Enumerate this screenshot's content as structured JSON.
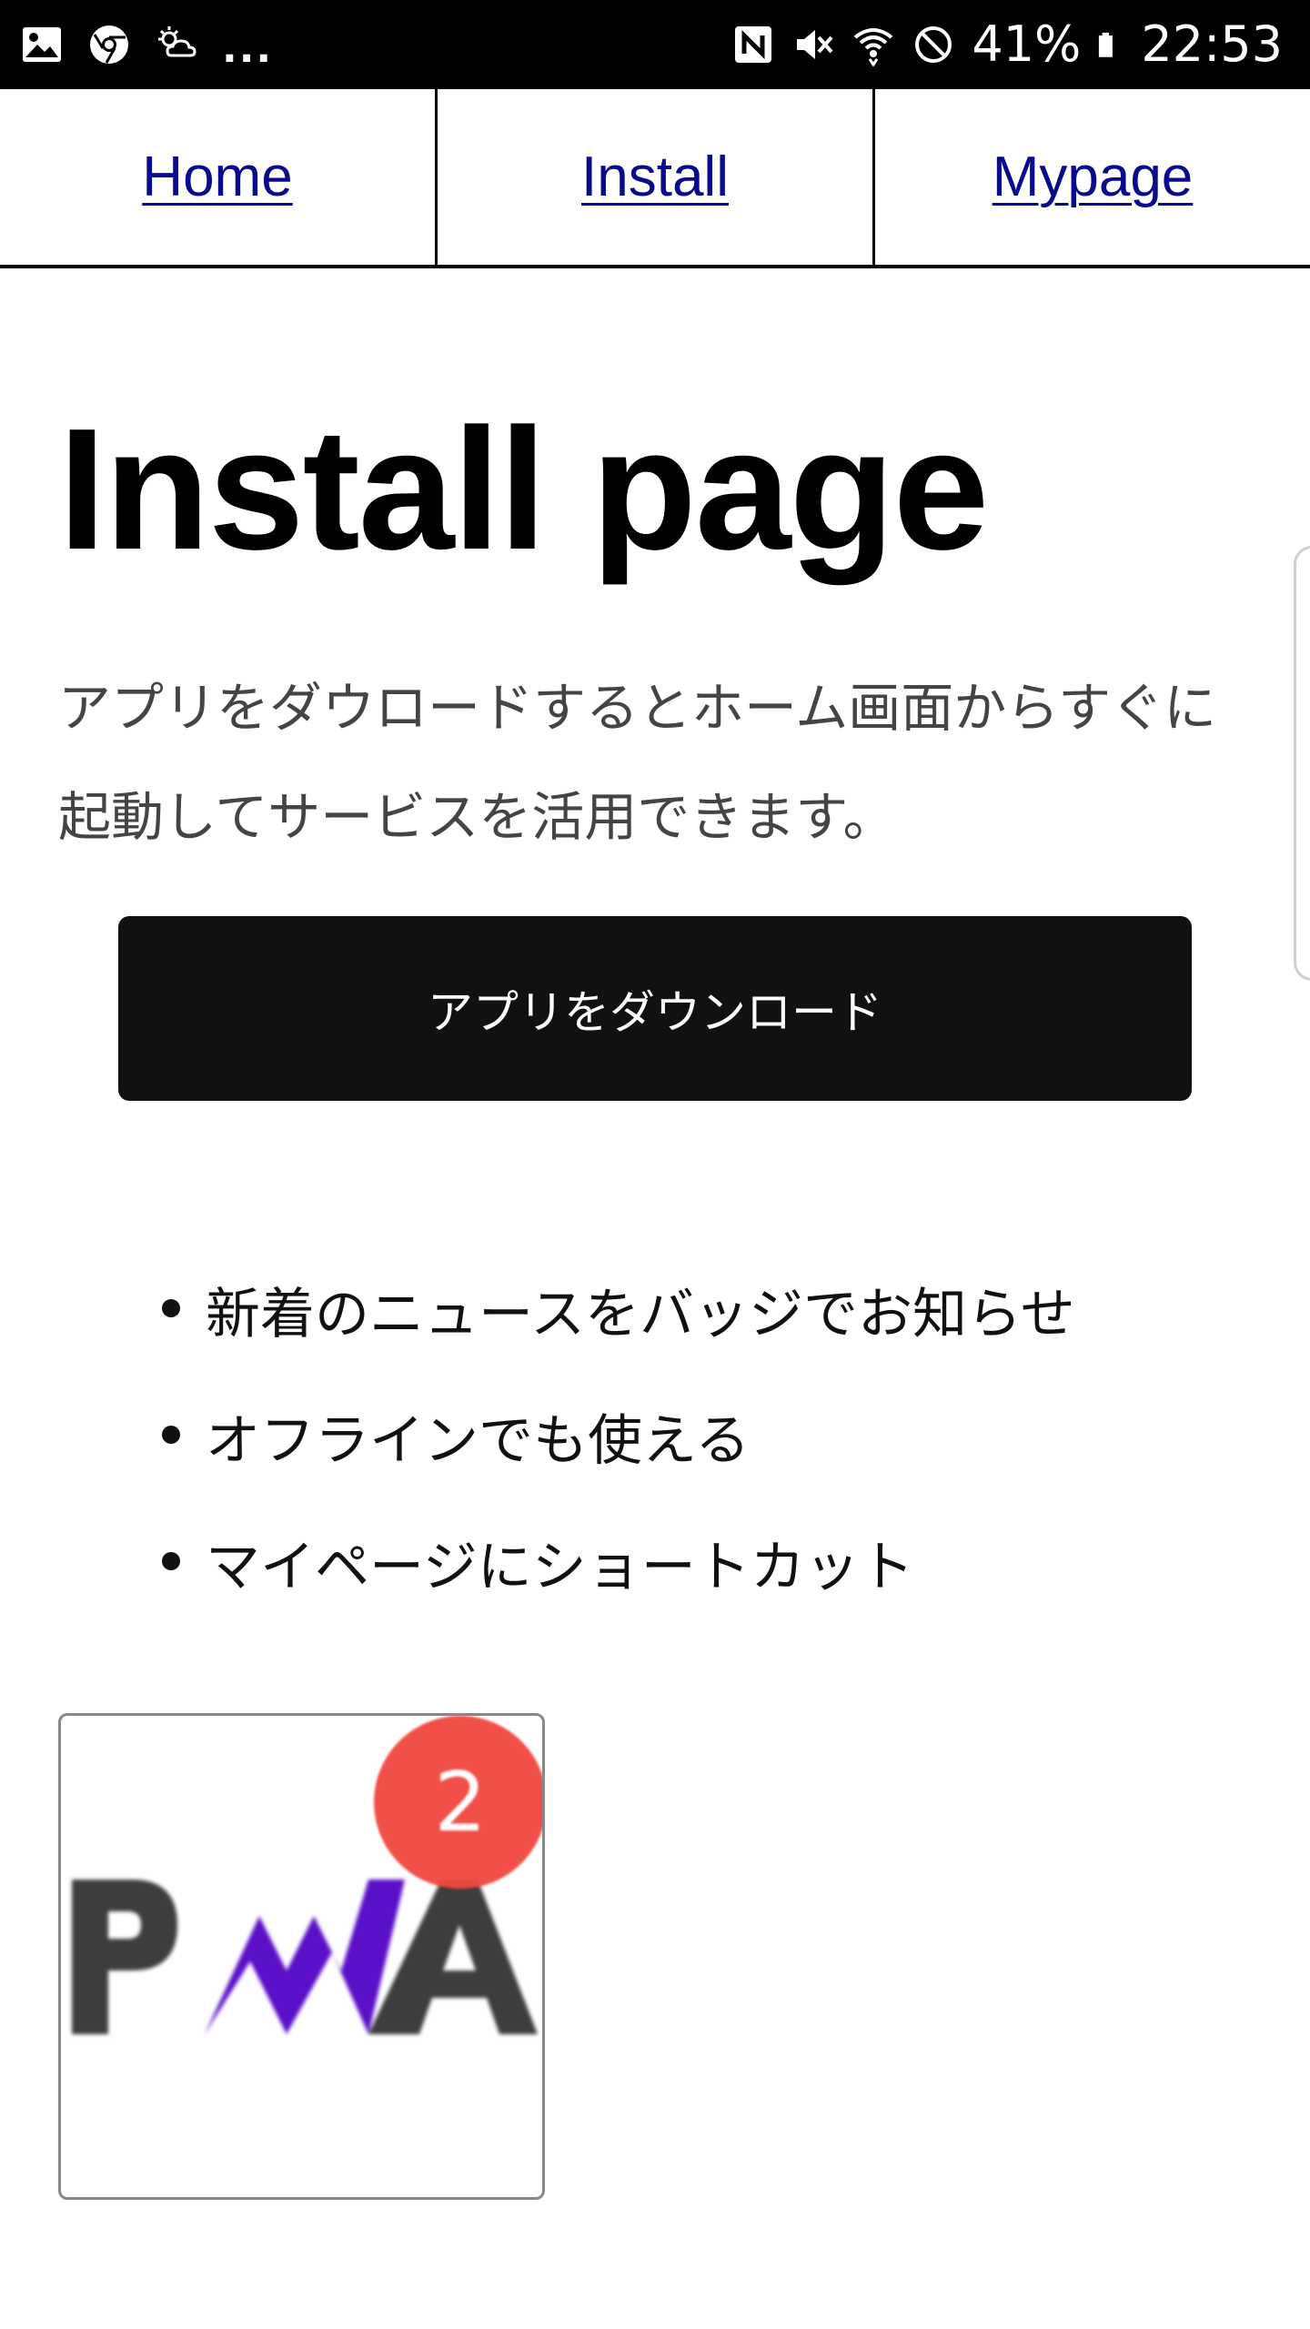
{
  "status_bar": {
    "battery": "41%",
    "time": "22:53",
    "overflow": "...",
    "icons_left": [
      "gallery-icon",
      "chrome-icon",
      "weather-icon"
    ],
    "icons_right": [
      "nfc-icon",
      "vibrate-icon",
      "wifi-icon",
      "do-not-disturb-icon",
      "battery-icon"
    ]
  },
  "nav": {
    "items": [
      {
        "label": "Home"
      },
      {
        "label": "Install"
      },
      {
        "label": "Mypage"
      }
    ]
  },
  "main": {
    "title": "Install page",
    "intro": "アプリをダウロードするとホーム画面からすぐに起動してサービスを活用できます。",
    "download_label": "アプリをダウンロード",
    "features": [
      "新着のニュースをバッジでお知らせ",
      "オフラインでも使える",
      "マイページにショートカット"
    ]
  },
  "app_icon": {
    "logo_text": "PWA",
    "badge_count": "2"
  },
  "colors": {
    "link": "#0a0a8c",
    "button_bg": "#111111",
    "badge": "#f0473f",
    "pwa_gray": "#3d3d3d",
    "pwa_purple": "#5a0fc8"
  }
}
